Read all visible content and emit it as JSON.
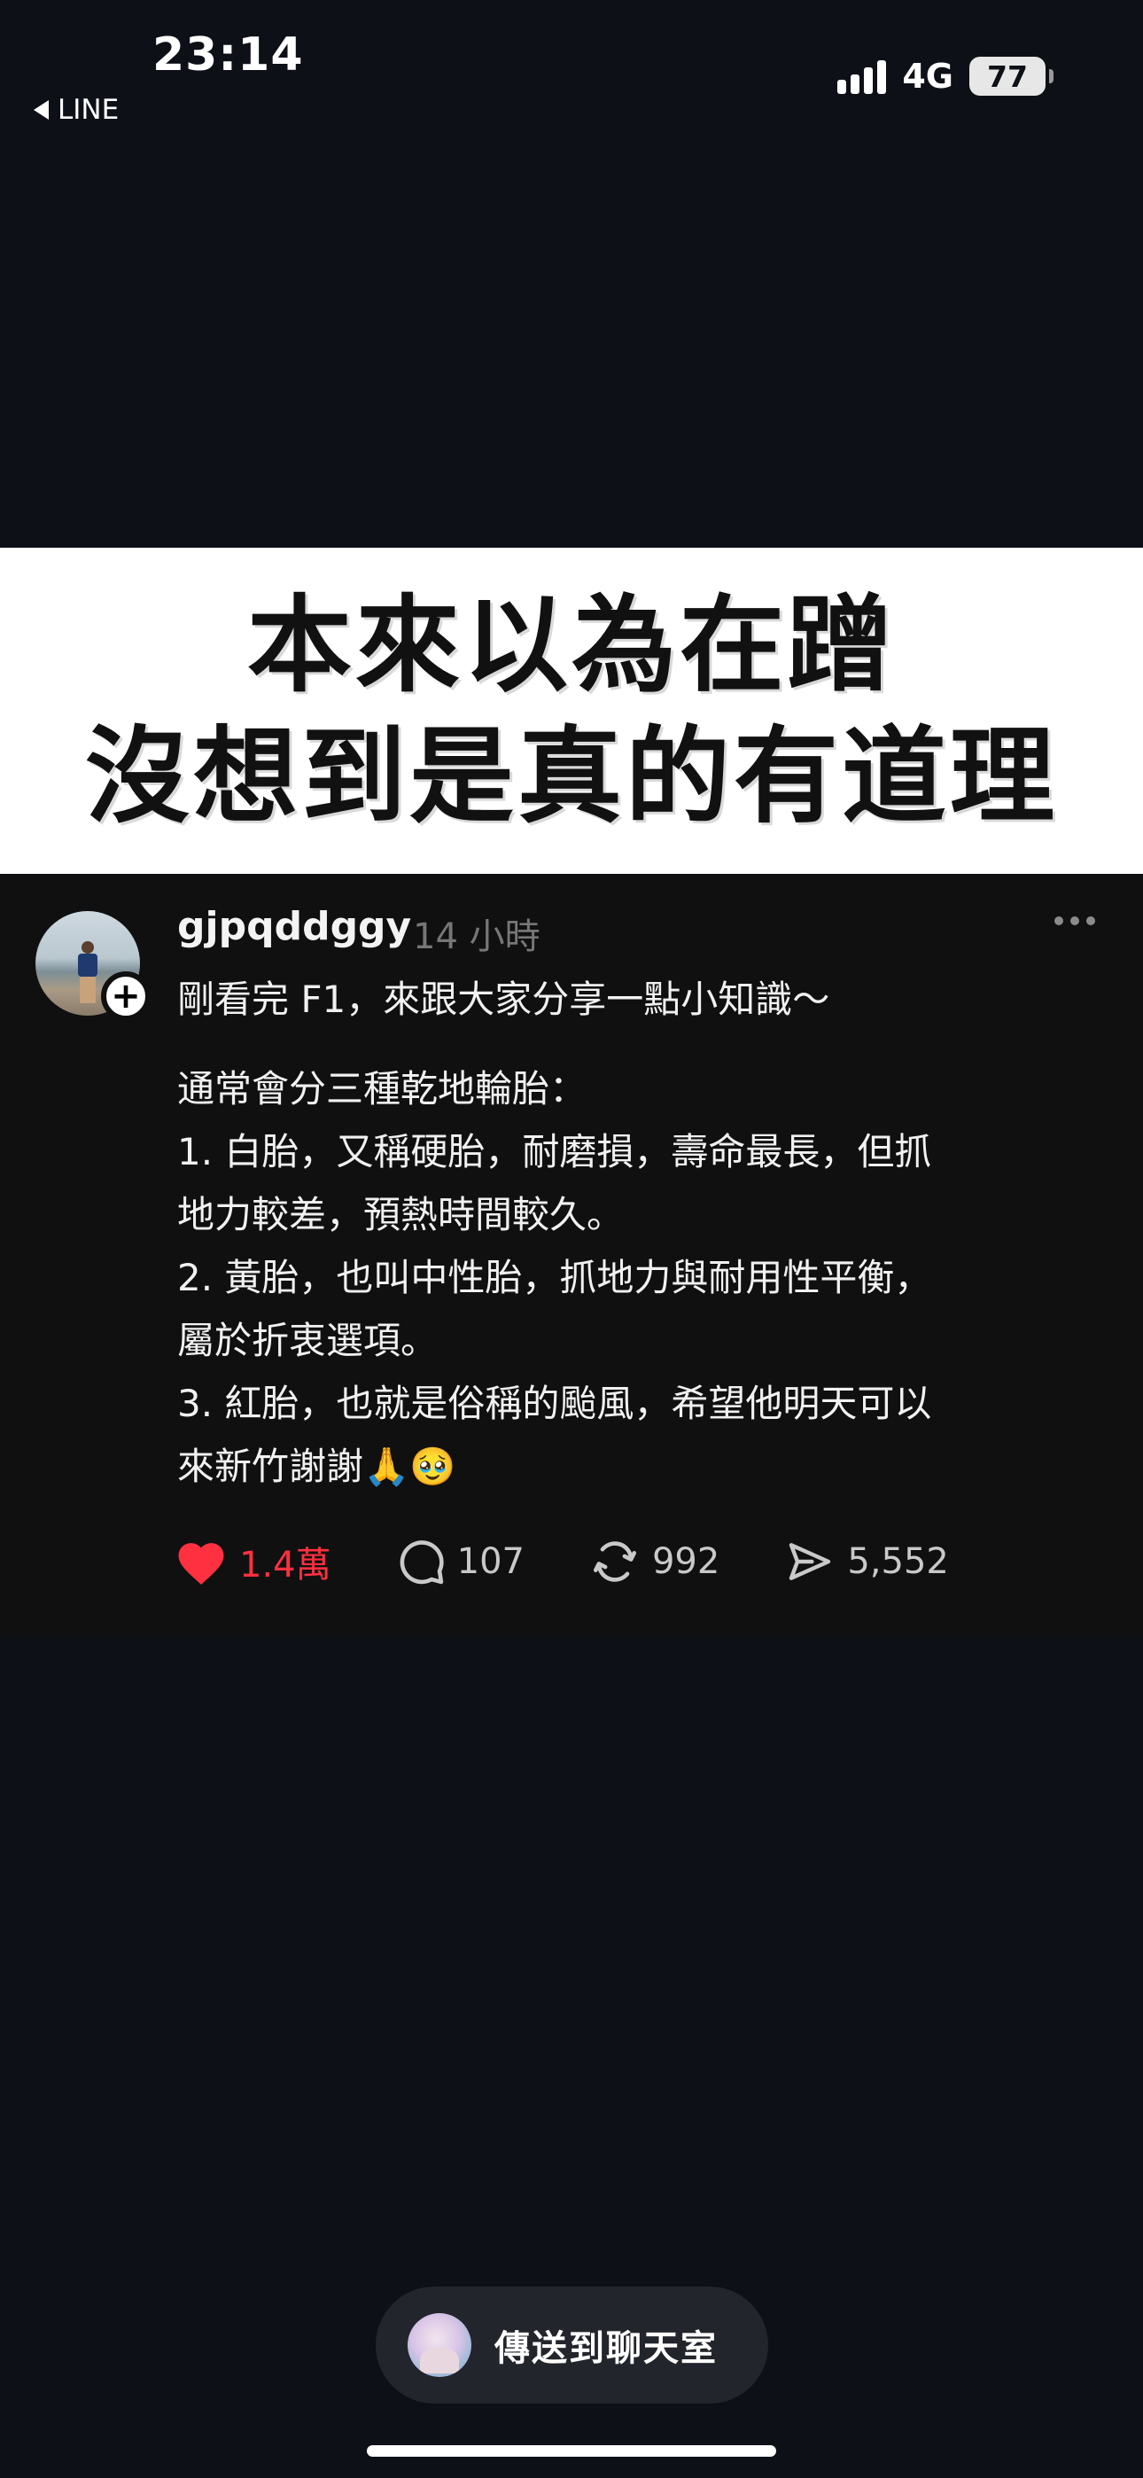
{
  "status_bar": {
    "time": "23:14",
    "back_app": "LINE",
    "network": "4G",
    "battery": "77"
  },
  "banner": {
    "line1": "本來以為在蹭",
    "line2": "沒想到是真的有道理"
  },
  "post": {
    "username": "gjpqddggy",
    "time_ago": "14 小時",
    "text_lines": [
      "剛看完 F1，來跟大家分享一點小知識～",
      "通常會分三種乾地輪胎：",
      "1. 白胎，又稱硬胎，耐磨損，壽命最長，但抓",
      "地力較差，預熱時間較久。",
      "2. 黃胎，也叫中性胎，抓地力與耐用性平衡，",
      "屬於折衷選項。",
      "3. 紅胎，也就是俗稱的颱風，希望他明天可以",
      "來新竹謝謝🙏🥹"
    ],
    "actions": {
      "likes": "1.4萬",
      "comments": "107",
      "reposts": "992",
      "shares": "5,552"
    },
    "like_color": "#ff3040"
  },
  "send_pill": {
    "label": "傳送到聊天室"
  },
  "icons": {
    "back": "back-triangle-icon",
    "signal": "signal-bars-icon",
    "battery": "battery-icon",
    "more": "more-dots-icon",
    "like": "heart-icon",
    "comment": "comment-bubble-icon",
    "repost": "repost-icon",
    "share": "send-icon",
    "follow": "plus-icon"
  }
}
